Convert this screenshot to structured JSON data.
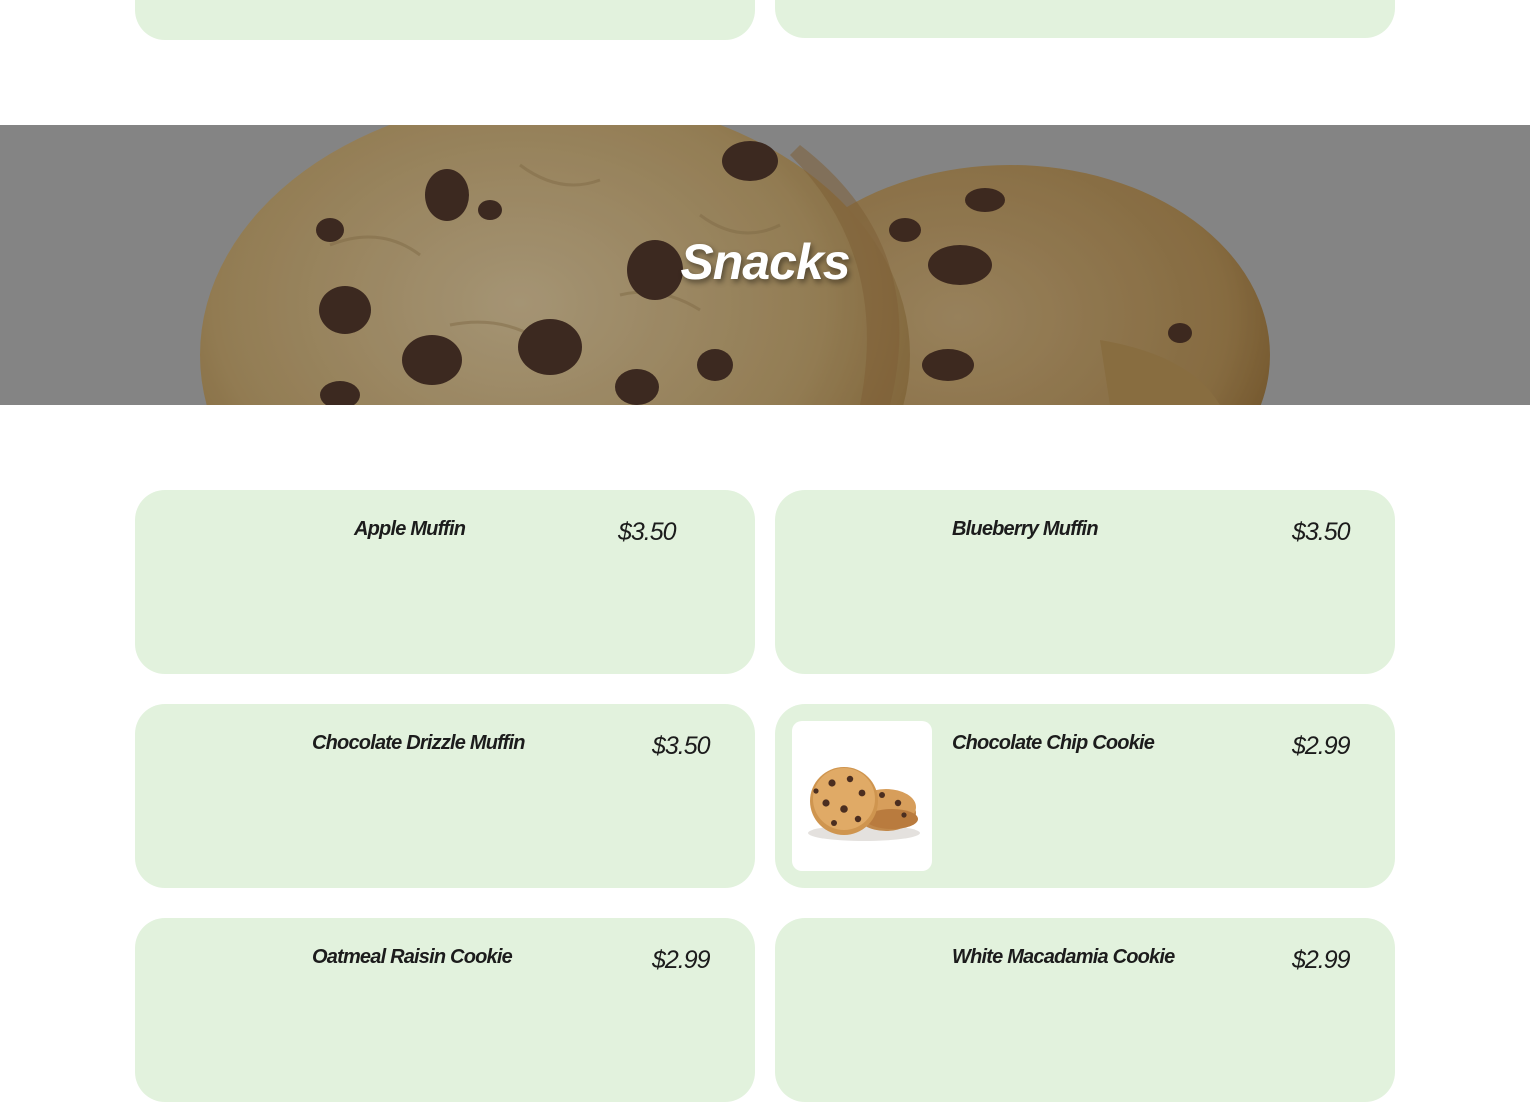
{
  "section": {
    "title": "Snacks",
    "overlay_color": "#a2a2a2"
  },
  "colors": {
    "card_background": "#e2f2dd",
    "page_background": "#ffffff",
    "text": "#1c1c1c"
  },
  "items": [
    {
      "name": "Apple Muffin",
      "price": "$3.50",
      "image": "none"
    },
    {
      "name": "Blueberry Muffin",
      "price": "$3.50",
      "image": "none"
    },
    {
      "name": "Chocolate Drizzle Muffin",
      "price": "$3.50",
      "image": "none"
    },
    {
      "name": "Chocolate Chip Cookie",
      "price": "$2.99",
      "image": "cookie-photo"
    },
    {
      "name": "Oatmeal Raisin Cookie",
      "price": "$2.99",
      "image": "none"
    },
    {
      "name": "White Macadamia Cookie",
      "price": "$2.99",
      "image": "none"
    }
  ]
}
